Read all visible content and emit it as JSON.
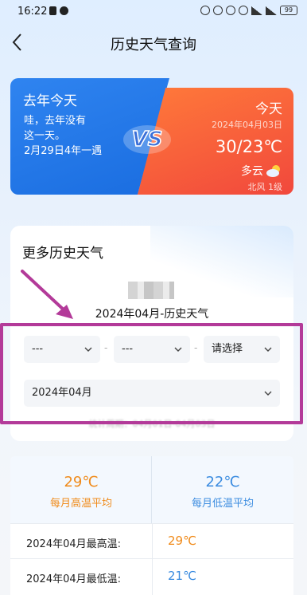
{
  "status_bar": {
    "time": "16:22",
    "battery": "99"
  },
  "nav": {
    "title": "历史天气查询"
  },
  "comparison": {
    "last_year": {
      "title": "去年今天",
      "note_line1": "哇，去年没有",
      "note_line2": "这一天。",
      "note_line3": "2月29日4年一遇"
    },
    "today": {
      "title": "今天",
      "date": "2024年04月03日",
      "temp": "30/23℃",
      "weather": "多云",
      "wind": "北风 1级"
    },
    "badge": "VS"
  },
  "history": {
    "title": "更多历史天气",
    "month_heading": "2024年04月-历史天气",
    "selects": {
      "year": "---",
      "month": "---",
      "day": "请选择",
      "period": "2024年04月"
    },
    "separator": "-",
    "stat_range": "统计周期：04月01日-04月03日"
  },
  "stats": {
    "avg_high": {
      "value": "29℃",
      "label": "每月高温平均"
    },
    "avg_low": {
      "value": "22℃",
      "label": "每月低温平均"
    },
    "rows": [
      {
        "label": "2024年04月最高温:",
        "value": "29℃"
      },
      {
        "label": "2024年04月最低温:",
        "value": "21℃"
      }
    ]
  },
  "colors": {
    "accent_orange": "#f08b1b",
    "accent_blue": "#3b8ce0",
    "annotation": "#b33a99"
  }
}
